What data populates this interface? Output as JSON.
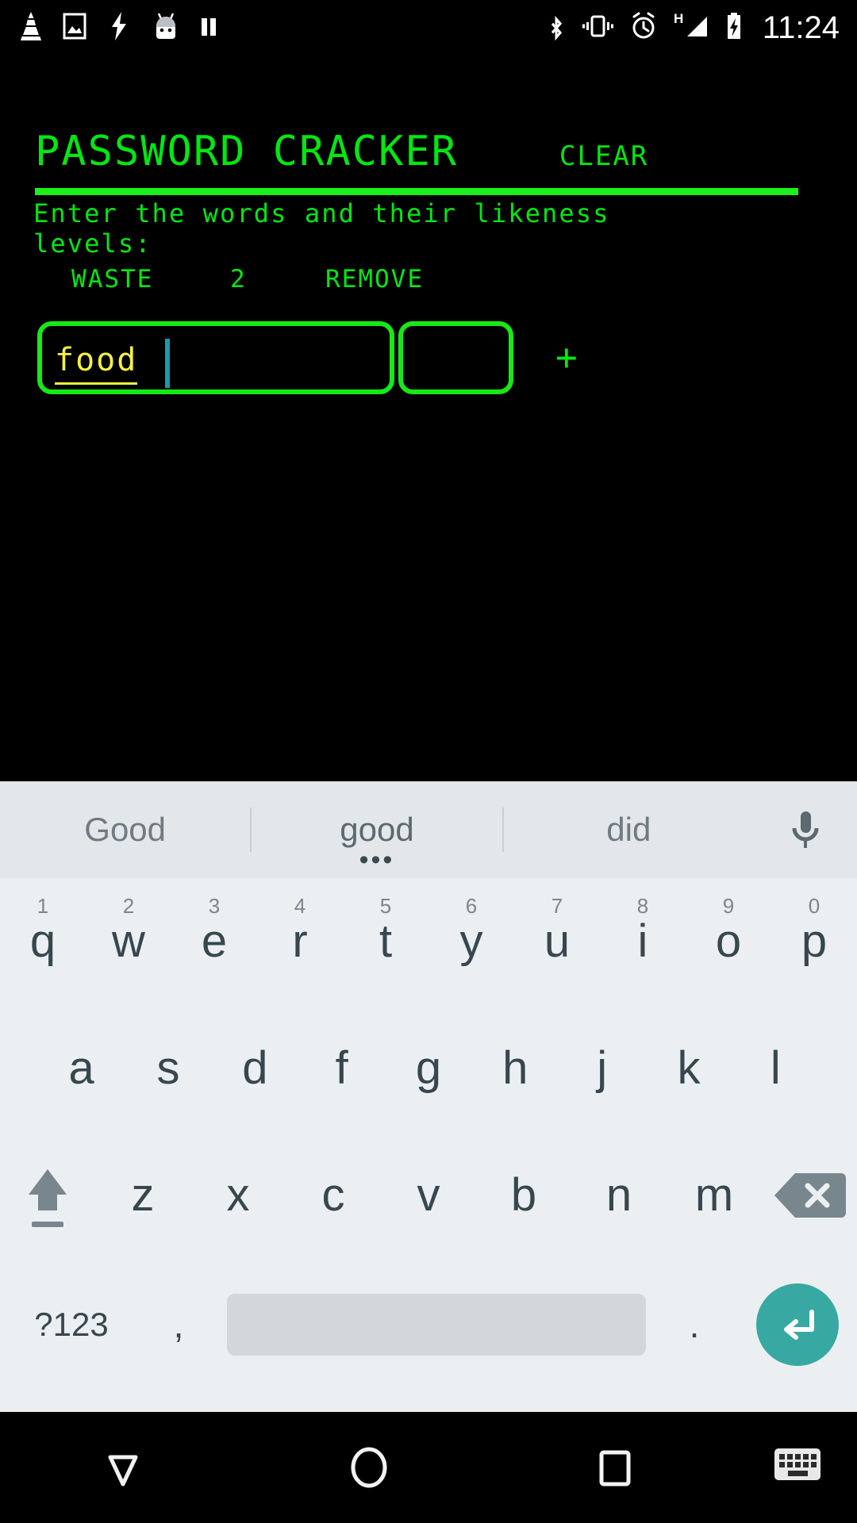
{
  "status_bar": {
    "icons_left": [
      "vlc-cone-icon",
      "image-icon",
      "lightning-icon",
      "android-head-icon",
      "pause-icon"
    ],
    "icons_right": [
      "bluetooth-icon",
      "vibrate-icon",
      "alarm-icon",
      "hspa-signal-icon",
      "battery-charging-icon"
    ],
    "network_label": "H",
    "clock": "11:24"
  },
  "app": {
    "title": "PASSWORD CRACKER",
    "clear_label": "CLEAR",
    "instructions": "Enter the words and their likeness\nlevels:",
    "accent_green": "#00e810",
    "rule_green": "#1bf01b",
    "field_border": "#16e916",
    "text_yellow": "#f5f141",
    "caret_color": "#1b9aaa",
    "columns": {
      "word": "WASTE",
      "level": "2",
      "remove": "REMOVE"
    },
    "rows": [
      {
        "word_value": "food",
        "word_placeholder": "",
        "level_value": "",
        "level_placeholder": ""
      }
    ],
    "add_row_label": "+"
  },
  "keyboard": {
    "suggestions": [
      {
        "text": "Good",
        "primary": false
      },
      {
        "text": "good",
        "primary": true
      },
      {
        "text": "did",
        "primary": false
      }
    ],
    "suggestion_dots": "•••",
    "mic_icon": "microphone-icon",
    "row1": [
      {
        "letter": "q",
        "num": "1"
      },
      {
        "letter": "w",
        "num": "2"
      },
      {
        "letter": "e",
        "num": "3"
      },
      {
        "letter": "r",
        "num": "4"
      },
      {
        "letter": "t",
        "num": "5"
      },
      {
        "letter": "y",
        "num": "6"
      },
      {
        "letter": "u",
        "num": "7"
      },
      {
        "letter": "i",
        "num": "8"
      },
      {
        "letter": "o",
        "num": "9"
      },
      {
        "letter": "p",
        "num": "0"
      }
    ],
    "row2": [
      {
        "letter": "a"
      },
      {
        "letter": "s"
      },
      {
        "letter": "d"
      },
      {
        "letter": "f"
      },
      {
        "letter": "g"
      },
      {
        "letter": "h"
      },
      {
        "letter": "j"
      },
      {
        "letter": "k"
      },
      {
        "letter": "l"
      }
    ],
    "row3": [
      {
        "letter": "z"
      },
      {
        "letter": "x"
      },
      {
        "letter": "c"
      },
      {
        "letter": "v"
      },
      {
        "letter": "b"
      },
      {
        "letter": "n"
      },
      {
        "letter": "m"
      }
    ],
    "shift_icon": "shift-arrow-icon",
    "backspace_icon": "backspace-icon",
    "symbols_label": "?123",
    "comma_label": ",",
    "period_label": ".",
    "space_label": "",
    "enter_icon": "enter-arrow-icon",
    "enter_color": "#37a9a2"
  },
  "nav_bar": {
    "back": "back-triangle-icon",
    "home": "home-circle-icon",
    "recents": "recents-square-icon",
    "hide_keyboard": "hide-keyboard-icon"
  }
}
